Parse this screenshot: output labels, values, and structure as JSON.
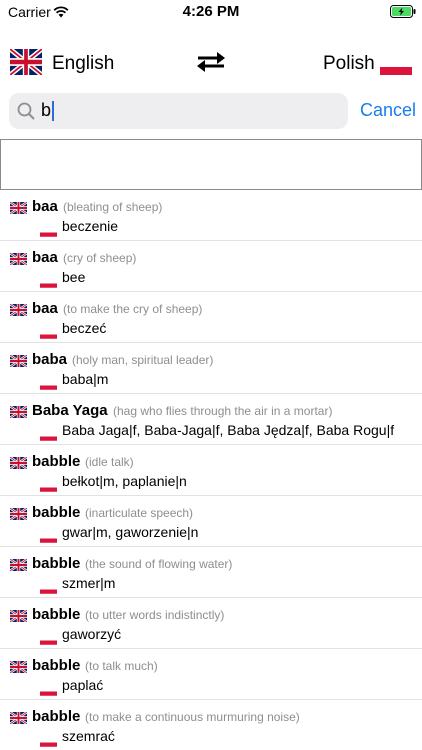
{
  "status_bar": {
    "carrier": "Carrier",
    "time": "4:26 PM"
  },
  "language_bar": {
    "source": "English",
    "target": "Polish"
  },
  "search": {
    "query": "b",
    "cancel_label": "Cancel"
  },
  "colors": {
    "accent": "#1a7cf0",
    "pl_red": "#dc143c",
    "note_gray": "#8e8e93",
    "battery_green": "#4cd964"
  },
  "icons": {
    "wifi": "wifi-icon",
    "battery": "battery-charging-icon",
    "swap": "swap-arrows-icon",
    "search": "search-icon",
    "flag_en": "uk-flag-icon",
    "flag_pl": "poland-flag-icon"
  },
  "results": [
    {
      "term": "baa",
      "note": "(bleating of sheep)",
      "translation": "beczenie"
    },
    {
      "term": "baa",
      "note": "(cry of sheep)",
      "translation": "bee"
    },
    {
      "term": "baa",
      "note": "(to make the cry of sheep)",
      "translation": "beczeć"
    },
    {
      "term": "baba",
      "note": "(holy man, spiritual leader)",
      "translation": "baba|m"
    },
    {
      "term": "Baba Yaga",
      "note": "(hag who flies through the air in a mortar)",
      "translation": "Baba Jaga|f, Baba-Jaga|f, Baba Jędza|f, Baba Rogu|f"
    },
    {
      "term": "babble",
      "note": "(idle talk)",
      "translation": "bełkot|m, paplanie|n"
    },
    {
      "term": "babble",
      "note": "(inarticulate speech)",
      "translation": "gwar|m, gaworzenie|n"
    },
    {
      "term": "babble",
      "note": "(the sound of flowing water)",
      "translation": "szmer|m"
    },
    {
      "term": "babble",
      "note": "(to utter words indistinctly)",
      "translation": "gaworzyć"
    },
    {
      "term": "babble",
      "note": "(to talk much)",
      "translation": "paplać"
    },
    {
      "term": "babble",
      "note": "(to make a continuous murmuring noise)",
      "translation": "szemrać"
    }
  ]
}
